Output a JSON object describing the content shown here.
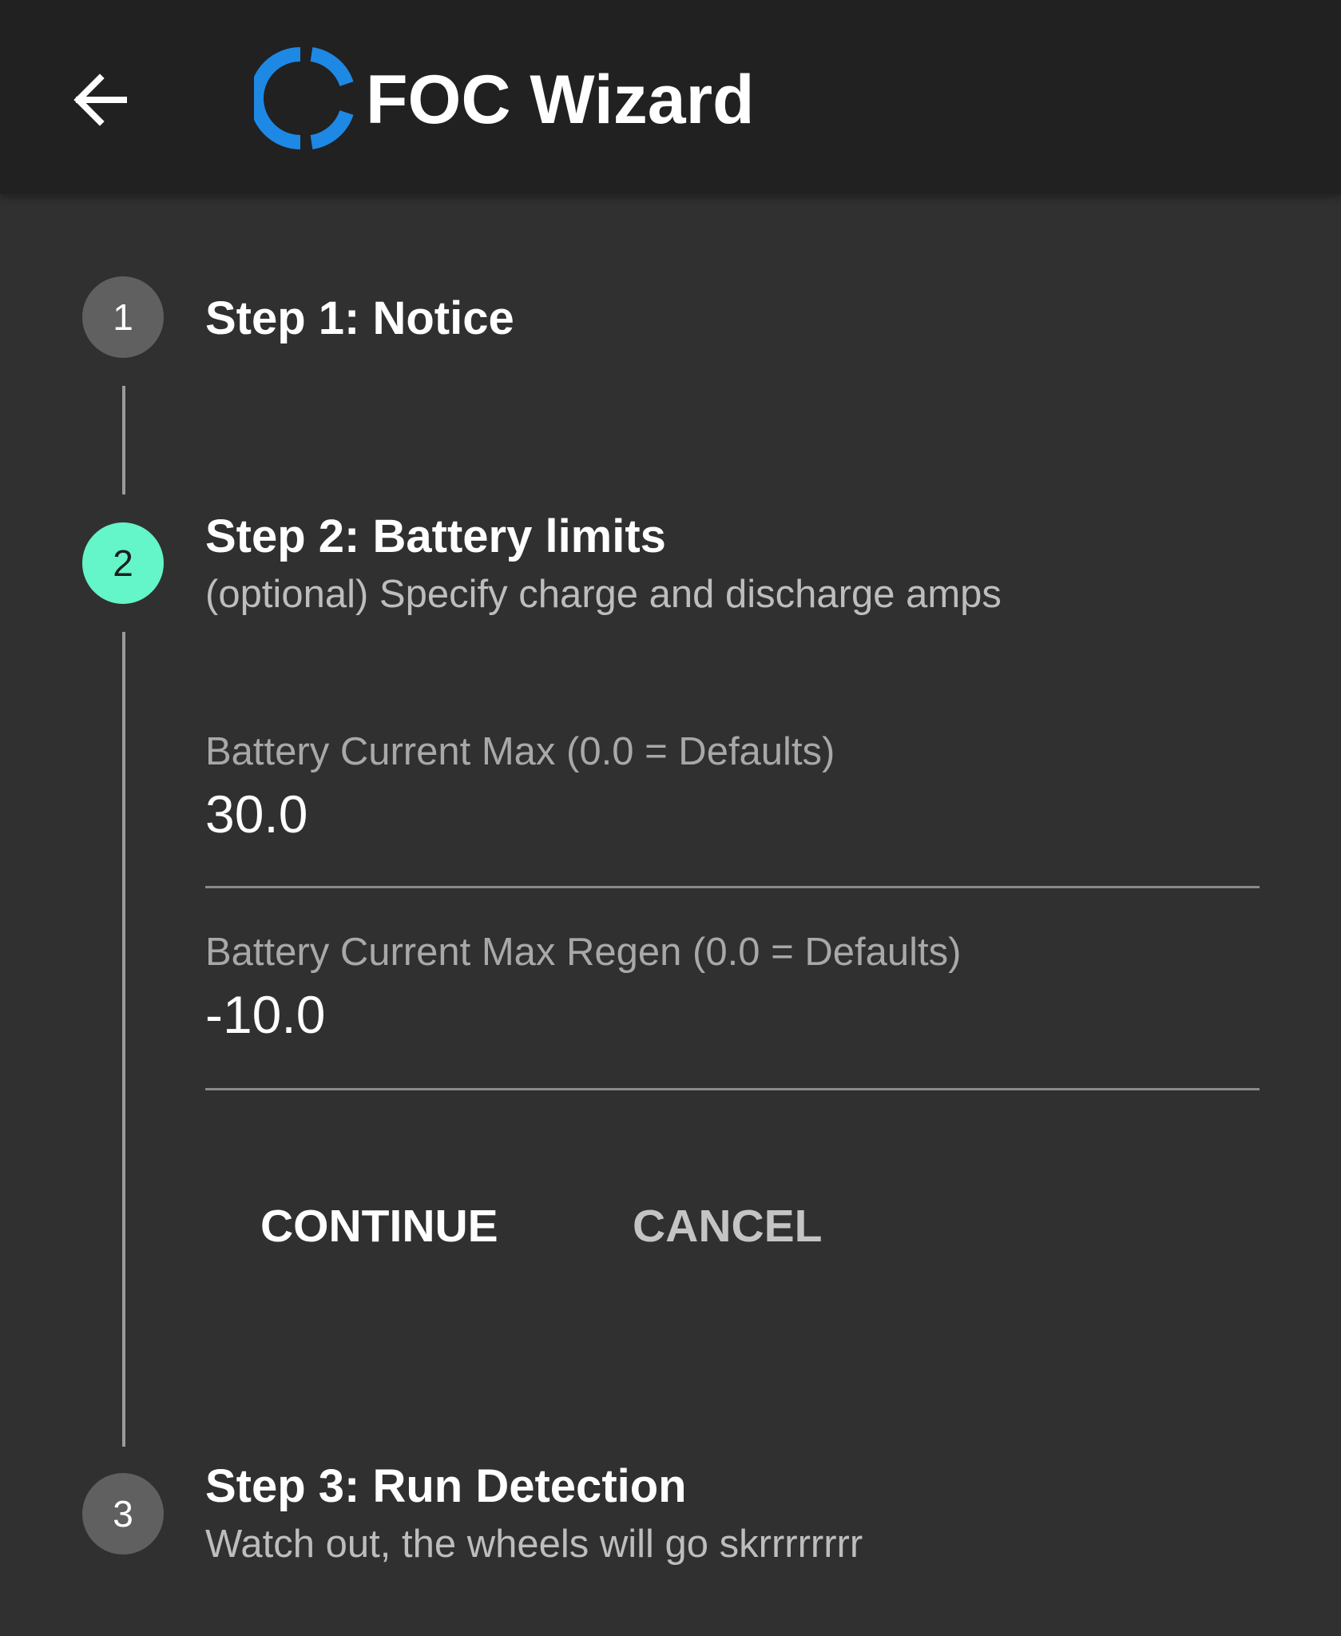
{
  "header": {
    "back_icon": "arrow-left-icon",
    "logo_icon": "foc-ring-logo-icon",
    "logo_color": "#1e88e5",
    "title": "FOC Wizard"
  },
  "steps": [
    {
      "number": "1",
      "title": "Step 1: Notice",
      "subtitle": "",
      "state": "completed"
    },
    {
      "number": "2",
      "title": "Step 2: Battery limits",
      "subtitle": "(optional) Specify charge and discharge amps",
      "state": "active",
      "fields": [
        {
          "label": "Battery Current Max (0.0 = Defaults)",
          "value": "30.0"
        },
        {
          "label": "Battery Current Max Regen (0.0 = Defaults)",
          "value": "-10.0"
        }
      ],
      "actions": {
        "continue_label": "CONTINUE",
        "cancel_label": "CANCEL"
      }
    },
    {
      "number": "3",
      "title": "Step 3: Run Detection",
      "subtitle": "Watch out, the wheels will go skrrrrrrrr",
      "state": "pending"
    }
  ],
  "colors": {
    "active_step": "#64f5c8",
    "inactive_step": "#606060",
    "background": "#303030",
    "toolbar": "#212121"
  }
}
